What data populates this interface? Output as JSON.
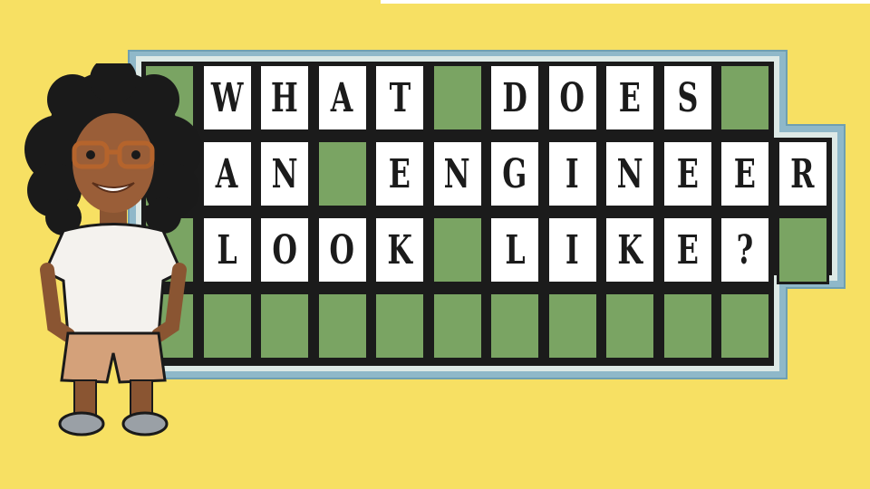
{
  "puzzle": {
    "rows": [
      [
        "",
        "W",
        "H",
        "A",
        "T",
        "",
        "D",
        "O",
        "E",
        "S",
        "",
        ""
      ],
      [
        "",
        "A",
        "N",
        "",
        "E",
        "N",
        "G",
        "I",
        "N",
        "E",
        "E",
        "R"
      ],
      [
        "",
        "L",
        "O",
        "O",
        "K",
        "",
        "L",
        "I",
        "K",
        "E",
        "?",
        ""
      ],
      [
        "",
        "",
        "",
        "",
        "",
        "",
        "",
        "",
        "",
        "",
        "",
        ""
      ]
    ]
  },
  "colors": {
    "background": "#f7e063",
    "tile_green": "#7aa463",
    "tile_white": "#ffffff",
    "frame_outer": "#8fb8c9",
    "frame_inner": "#dde9e6",
    "tile_border": "#1b1b1b"
  },
  "avatar": {
    "icon": "cartoon-engineer-avatar"
  }
}
